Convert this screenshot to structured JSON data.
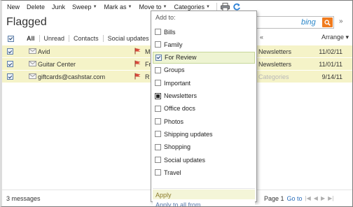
{
  "toolbar": {
    "items": [
      {
        "label": "New",
        "has_caret": false
      },
      {
        "label": "Delete",
        "has_caret": false
      },
      {
        "label": "Junk",
        "has_caret": false
      },
      {
        "label": "Sweep",
        "has_caret": true
      },
      {
        "label": "Mark as",
        "has_caret": true
      },
      {
        "label": "Move to",
        "has_caret": true
      },
      {
        "label": "Categories",
        "has_caret": true
      }
    ],
    "icons": [
      "print-icon",
      "refresh-icon"
    ]
  },
  "folder": {
    "title": "Flagged"
  },
  "search": {
    "brand": "bing",
    "value": ""
  },
  "filters": {
    "items": [
      "All",
      "Unread",
      "Contacts",
      "Social updates"
    ],
    "active": "All",
    "prev_symbol": "«",
    "arrange_label": "Arrange",
    "arrange_caret": "▾"
  },
  "messages": [
    {
      "sender": "Avid",
      "subject_start": "M",
      "folder": "Newsletters",
      "folder_faded": false,
      "date": "11/02/11",
      "checked": true,
      "flagged": true
    },
    {
      "sender": "Guitar Center",
      "subject_start": "Fr",
      "folder": "Newsletters",
      "folder_faded": false,
      "date": "11/01/11",
      "checked": true,
      "flagged": true
    },
    {
      "sender": "giftcards@cashstar.com",
      "subject_start": "R",
      "folder": "Categories",
      "folder_faded": true,
      "date": "9/14/11",
      "checked": true,
      "flagged": true
    }
  ],
  "status": {
    "message_count": "3 messages",
    "page_label": "Page 1",
    "goto_label": "Go to"
  },
  "categories_menu": {
    "header": "Add to:",
    "items": [
      {
        "label": "Bills",
        "state": "unchecked"
      },
      {
        "label": "Family",
        "state": "unchecked"
      },
      {
        "label": "For Review",
        "state": "checked"
      },
      {
        "label": "Groups",
        "state": "unchecked"
      },
      {
        "label": "Important",
        "state": "unchecked"
      },
      {
        "label": "Newsletters",
        "state": "partial"
      },
      {
        "label": "Office docs",
        "state": "unchecked"
      },
      {
        "label": "Photos",
        "state": "unchecked"
      },
      {
        "label": "Shipping updates",
        "state": "unchecked"
      },
      {
        "label": "Shopping",
        "state": "unchecked"
      },
      {
        "label": "Social updates",
        "state": "unchecked"
      },
      {
        "label": "Travel",
        "state": "unchecked"
      }
    ],
    "highlighted": "For Review",
    "apply_label": "Apply",
    "apply_all_label": "Apply to all from..."
  },
  "colors": {
    "row_highlight": "#f5f3c8",
    "menu_highlight": "#eef4d2",
    "link": "#2a6ebb",
    "search_button": "#f07b1e"
  }
}
